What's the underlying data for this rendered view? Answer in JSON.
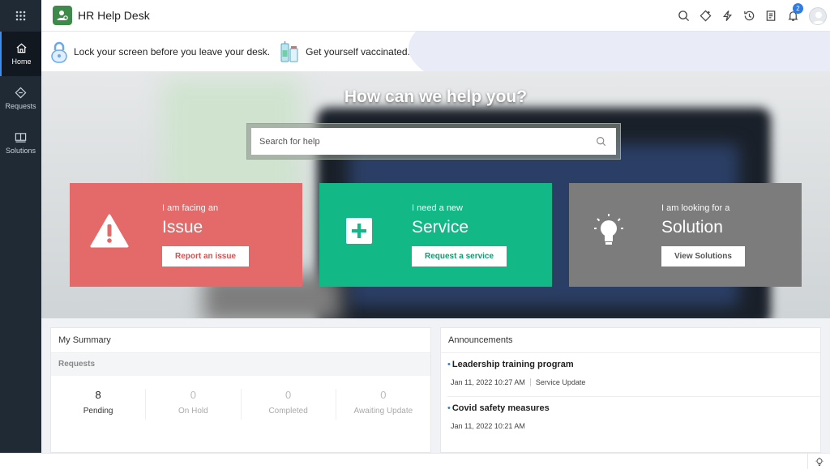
{
  "app": {
    "title": "HR Help Desk"
  },
  "nav": {
    "items": [
      {
        "label": "Home",
        "icon": "home-icon",
        "active": true
      },
      {
        "label": "Requests",
        "icon": "requests-icon"
      },
      {
        "label": "Solutions",
        "icon": "solutions-icon"
      }
    ]
  },
  "topbar": {
    "icons": [
      "search-icon",
      "sparkle-icon",
      "lightning-icon",
      "history-icon",
      "notes-icon",
      "bell-icon"
    ],
    "notification_count": "2"
  },
  "messages": [
    {
      "text": "Lock your screen before you leave your desk.",
      "icon": "lock-icon"
    },
    {
      "text": "Get yourself vaccinated.",
      "icon": "vaccine-icon"
    }
  ],
  "hero": {
    "title": "How can we help you?",
    "search_placeholder": "Search for help"
  },
  "cards": [
    {
      "small": "I am facing an",
      "big": "Issue",
      "button": "Report an issue",
      "color": "#e46969",
      "icon": "warning-icon"
    },
    {
      "small": "I need a new",
      "big": "Service",
      "button": "Request a service",
      "color": "#12b886",
      "icon": "plus-icon"
    },
    {
      "small": "I am looking for a",
      "big": "Solution",
      "button": "View Solutions",
      "color": "#7c7c7c",
      "icon": "lightbulb-icon"
    }
  ],
  "summary": {
    "title": "My Summary",
    "section": "Requests",
    "stats": [
      {
        "value": "8",
        "label": "Pending"
      },
      {
        "value": "0",
        "label": "On Hold"
      },
      {
        "value": "0",
        "label": "Completed"
      },
      {
        "value": "0",
        "label": "Awaiting Update"
      }
    ]
  },
  "announcements": {
    "title": "Announcements",
    "items": [
      {
        "title": "Leadership training program",
        "date": "Jan 11, 2022 10:27 AM",
        "tag": "Service Update"
      },
      {
        "title": "Covid safety measures",
        "date": "Jan 11, 2022 10:21 AM",
        "tag": ""
      }
    ]
  }
}
